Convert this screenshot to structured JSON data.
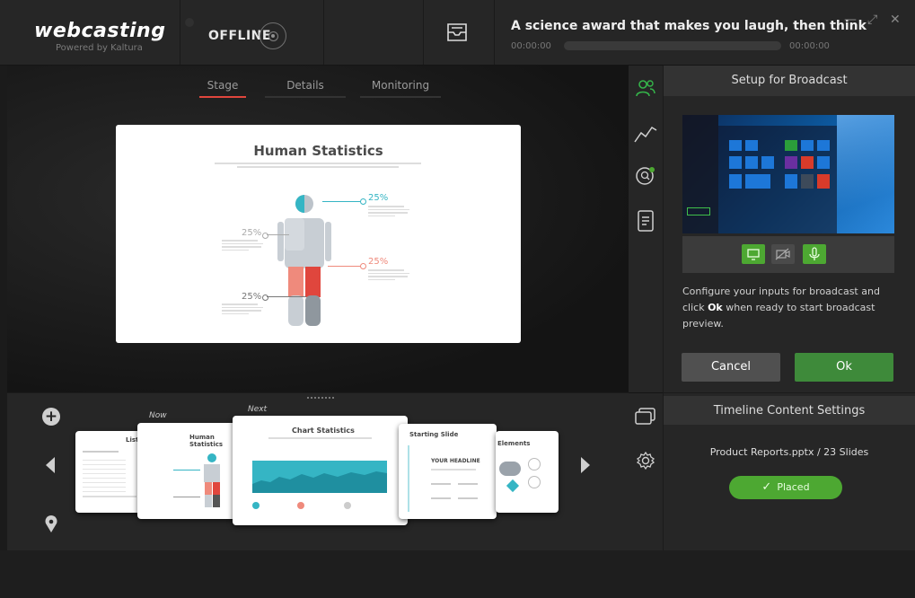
{
  "app": {
    "logo": "webcasting",
    "logo_sub": "Powered by Kaltura",
    "status": "OFFLINE"
  },
  "event": {
    "title": "A science award that makes you laugh, then think",
    "time_start": "00:00:00",
    "time_end": "00:00:00",
    "progress": 0
  },
  "window_controls": [
    "minimize-icon",
    "expand-icon",
    "close-icon"
  ],
  "tabs": [
    {
      "label": "Stage",
      "active": true
    },
    {
      "label": "Details",
      "active": false
    },
    {
      "label": "Monitoring",
      "active": false
    }
  ],
  "slide": {
    "title": "Human Statistics",
    "stats": [
      "25",
      "25",
      "25",
      "25"
    ],
    "stat_unit": "%"
  },
  "side_icons": [
    "users-icon",
    "analytics-icon",
    "qa-icon",
    "document-icon",
    "slides-icon",
    "settings-icon"
  ],
  "setup": {
    "title": "Setup for Broadcast",
    "instruction_pre": "Configure your inputs for broadcast and click ",
    "instruction_bold": "Ok",
    "instruction_post": " when ready to start broadcast preview.",
    "cancel_label": "Cancel",
    "ok_label": "Ok"
  },
  "timeline": {
    "now_label": "Now",
    "next_label": "Next",
    "cards": [
      {
        "title": "List"
      },
      {
        "title": "Human Statistics"
      },
      {
        "title": "Chart Statistics"
      },
      {
        "title": "Starting Slide",
        "headline": "YOUR HEADLINE"
      },
      {
        "title": "Elements"
      }
    ]
  },
  "timeline_settings": {
    "title": "Timeline Content Settings",
    "file_info": "Product Reports.pptx / 23 Slides",
    "placed_label": "Placed"
  },
  "colors": {
    "accent_red": "#e0463d",
    "ok_green": "#3e8a3a",
    "placed_green": "#4da832",
    "teal": "#35b5c4",
    "salmon": "#ef8a7c"
  }
}
